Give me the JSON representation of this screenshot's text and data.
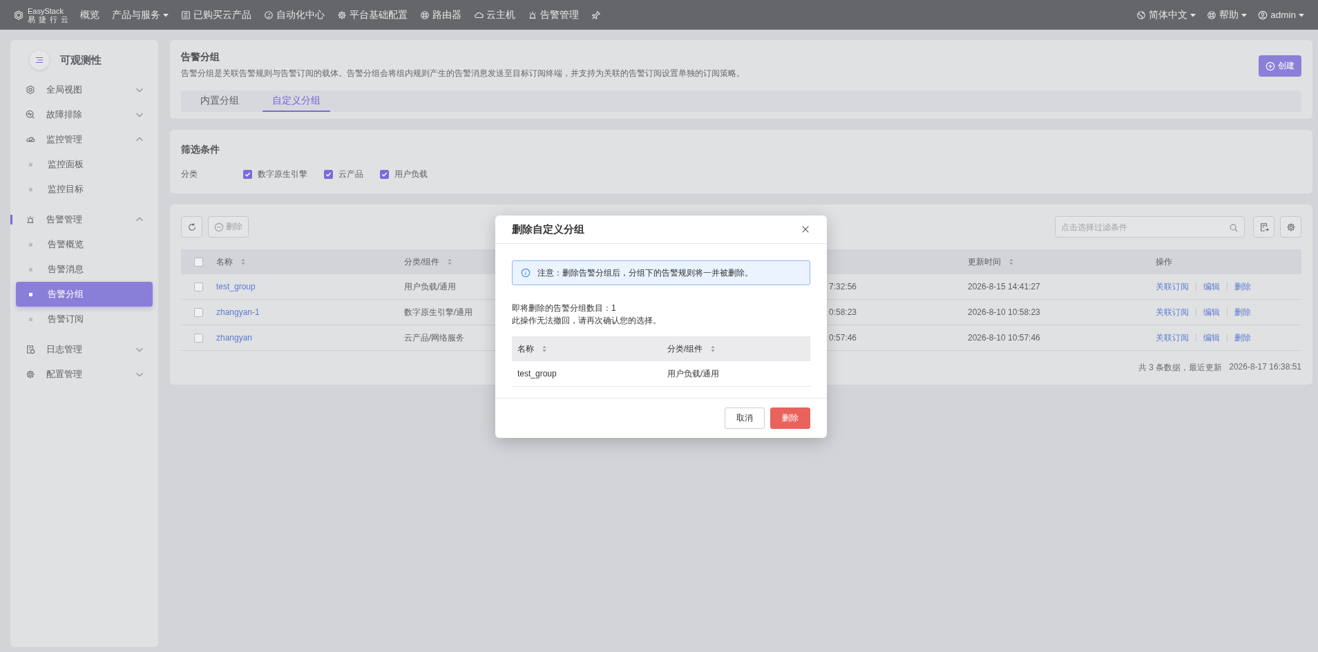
{
  "topbar": {
    "logo": {
      "name": "EasyStack",
      "sub": "易 捷 行 云"
    },
    "nav": [
      {
        "label": "概览",
        "dropdown": false
      },
      {
        "label": "产品与服务",
        "dropdown": true
      },
      {
        "label": "已购买云产品",
        "dropdown": false
      },
      {
        "label": "自动化中心",
        "dropdown": false
      },
      {
        "label": "平台基础配置",
        "dropdown": false
      },
      {
        "label": "路由器",
        "dropdown": false
      },
      {
        "label": "云主机",
        "dropdown": false
      },
      {
        "label": "告警管理",
        "dropdown": false
      }
    ],
    "right": [
      {
        "label": "简体中文",
        "dropdown": true
      },
      {
        "label": "帮助",
        "dropdown": true
      },
      {
        "label": "admin",
        "dropdown": true
      }
    ]
  },
  "sidebar": {
    "title": "可观测性",
    "items": [
      {
        "label": "全局视图",
        "expanded": false
      },
      {
        "label": "故障排除",
        "expanded": false
      },
      {
        "label": "监控管理",
        "expanded": true,
        "children": [
          {
            "label": "监控面板",
            "selected": false
          },
          {
            "label": "监控目标",
            "selected": false
          }
        ]
      },
      {
        "label": "告警管理",
        "expanded": true,
        "children": [
          {
            "label": "告警概览",
            "selected": false
          },
          {
            "label": "告警消息",
            "selected": false
          },
          {
            "label": "告警分组",
            "selected": true
          },
          {
            "label": "告警订阅",
            "selected": false
          }
        ]
      },
      {
        "label": "日志管理",
        "expanded": false
      },
      {
        "label": "配置管理",
        "expanded": false
      }
    ]
  },
  "header": {
    "title": "告警分组",
    "description": "告警分组是关联告警规则与告警订阅的载体。告警分组会将组内规则产生的告警消息发送至目标订阅终端，并支持为关联的告警订阅设置单独的订阅策略。",
    "create_button": "创建",
    "tabs": [
      {
        "label": "内置分组",
        "selected": false
      },
      {
        "label": "自定义分组",
        "selected": true
      }
    ]
  },
  "filter": {
    "title": "筛选条件",
    "label": "分类",
    "options": [
      {
        "label": "数字原生引擎",
        "checked": true
      },
      {
        "label": "云产品",
        "checked": true
      },
      {
        "label": "用户负载",
        "checked": true
      }
    ]
  },
  "toolbar": {
    "delete_button": {
      "label": "删除",
      "disabled": true
    },
    "search": {
      "placeholder": "点击选择过滤条件"
    }
  },
  "table": {
    "select_all_checked": false,
    "columns": [
      {
        "label": "名称",
        "sortable": true
      },
      {
        "label": "分类/组件",
        "sortable": true
      },
      {
        "label": "更新时间",
        "sortable": true
      },
      {
        "label": "操作",
        "sortable": false
      }
    ],
    "rows": [
      {
        "checked": false,
        "name": "test_group",
        "category": "用户负载/通用",
        "column_3": "7:32:56",
        "updated": "2026-8-15 14:41:27",
        "actions": [
          "关联订阅",
          "编辑",
          "删除"
        ]
      },
      {
        "checked": false,
        "name": "zhangyan-1",
        "category": "数字原生引擎/通用",
        "column_3": "0:58:23",
        "updated": "2026-8-10 10:58:23",
        "actions": [
          "关联订阅",
          "编辑",
          "删除"
        ]
      },
      {
        "checked": false,
        "name": "zhangyan",
        "category": "云产品/网络服务",
        "column_3": "0:57:46",
        "updated": "2026-8-10 10:57:46",
        "actions": [
          "关联订阅",
          "编辑",
          "删除"
        ]
      }
    ],
    "footer": {
      "summary": "共 3 条数据，最近更新",
      "time": "2026-8-17 16:38:51"
    }
  },
  "dialog": {
    "title": "删除自定义分组",
    "alert": "注意：删除告警分组后，分组下的告警规则将一并被删除。",
    "lines": [
      "即将删除的告警分组数目：1",
      "此操作无法撤回，请再次确认您的选择。"
    ],
    "columns": [
      {
        "label": "名称",
        "sortable": true
      },
      {
        "label": "分类/组件",
        "sortable": true
      }
    ],
    "rows": [
      {
        "name": "test_group",
        "category": "用户负载/通用"
      }
    ],
    "buttons": [
      {
        "label": "取消",
        "kind": "default"
      },
      {
        "label": "删除",
        "kind": "danger"
      }
    ]
  }
}
